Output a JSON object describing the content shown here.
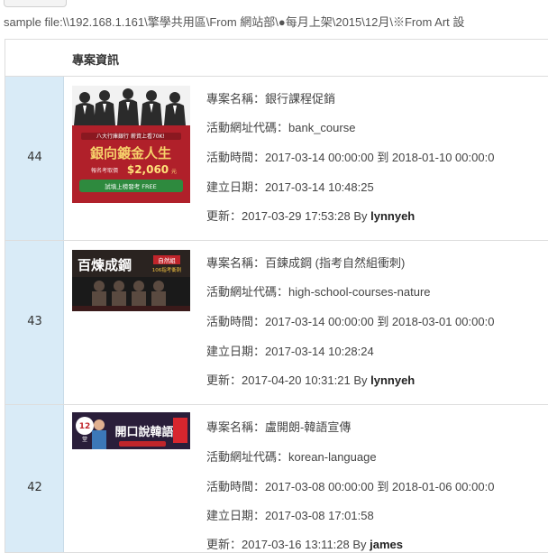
{
  "path_bar": {
    "text": "sample file:\\\\192.168.1.161\\擎學共用區\\From 網站部\\●每月上架\\2015\\12月\\※From Art 設"
  },
  "table": {
    "header": {
      "id": "",
      "details": "專案資訊"
    },
    "rows": [
      {
        "id": "44",
        "thumbnail": {
          "icon": "banner-thumbnail",
          "top_text": "八大行庫銀行 薪資上看70K!",
          "headline": "銀向鍍金人生",
          "price_label": "報名考取價",
          "price": "$2,060",
          "price_unit": "元",
          "cta": "試填上榜發考 FREE"
        },
        "name_line": "專案名稱：銀行課程促銷",
        "code_line": "活動網址代碼：bank_course",
        "time_line": "活動時間：2017-03-14 00:00:00 到 2018-01-10 00:00:0",
        "created_line": "建立日期：2017-03-14 10:48:25",
        "updated_prefix": "更新：2017-03-29 17:53:28 By ",
        "updated_by": "lynnyeh"
      },
      {
        "id": "43",
        "thumbnail": {
          "icon": "banner-thumbnail",
          "headline": "百煉成鋼",
          "sub": "自然組",
          "sub2": "106指考衝刺"
        },
        "name_line": "專案名稱：百鍊成鋼 (指考自然組衝刺)",
        "code_line": "活動網址代碼：high-school-courses-nature",
        "time_line": "活動時間：2017-03-14 00:00:00 到 2018-03-01 00:00:0",
        "created_line": "建立日期：2017-03-14 10:28:24",
        "updated_prefix": "更新：2017-04-20 10:31:21 By ",
        "updated_by": "lynnyeh"
      },
      {
        "id": "42",
        "thumbnail": {
          "icon": "banner-thumbnail",
          "badge": "12",
          "badge_unit": "堂",
          "headline": "開口說韓語"
        },
        "name_line": "專案名稱：盧開朗-韓語宣傳",
        "code_line": "活動網址代碼：korean-language",
        "time_line": "活動時間：2017-03-08 00:00:00 到 2018-01-06 00:00:0",
        "created_line": "建立日期：2017-03-08 17:01:58",
        "updated_prefix": "更新：2017-03-16 13:11:28 By ",
        "updated_by": "james"
      }
    ]
  },
  "colors": {
    "id_cell_bg": "#d9ebf7",
    "border": "#dddddd",
    "text": "#444444"
  }
}
